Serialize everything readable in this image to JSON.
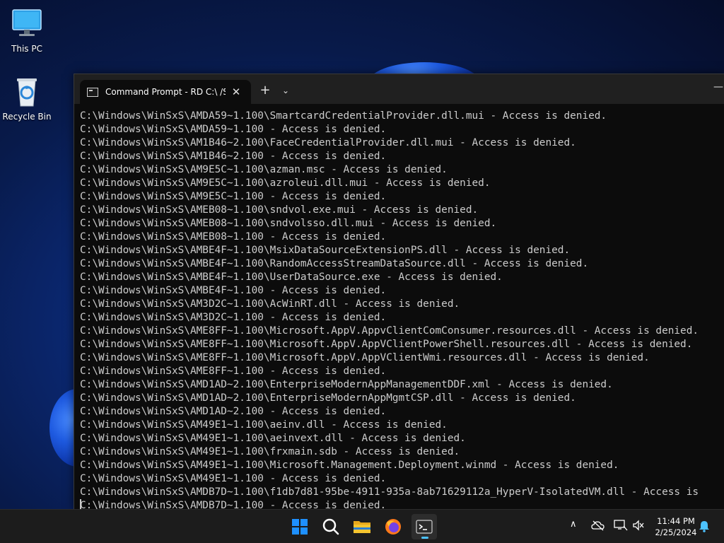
{
  "desktop": {
    "icons": [
      {
        "label": "This PC",
        "icon": "monitor-icon"
      },
      {
        "label": "Recycle Bin",
        "icon": "recycle-bin-icon"
      }
    ]
  },
  "terminal": {
    "tab_title": "Command Prompt - RD  C:\\ /S",
    "close_symbol": "✕",
    "new_tab_symbol": "+",
    "dropdown_symbol": "⌄",
    "minimize_symbol": "—",
    "lines": [
      "C:\\Windows\\WinSxS\\AMDA59~1.100\\SmartcardCredentialProvider.dll.mui - Access is denied.",
      "C:\\Windows\\WinSxS\\AMDA59~1.100 - Access is denied.",
      "C:\\Windows\\WinSxS\\AM1B46~2.100\\FaceCredentialProvider.dll.mui - Access is denied.",
      "C:\\Windows\\WinSxS\\AM1B46~2.100 - Access is denied.",
      "C:\\Windows\\WinSxS\\AM9E5C~1.100\\azman.msc - Access is denied.",
      "C:\\Windows\\WinSxS\\AM9E5C~1.100\\azroleui.dll.mui - Access is denied.",
      "C:\\Windows\\WinSxS\\AM9E5C~1.100 - Access is denied.",
      "C:\\Windows\\WinSxS\\AMEB08~1.100\\sndvol.exe.mui - Access is denied.",
      "C:\\Windows\\WinSxS\\AMEB08~1.100\\sndvolsso.dll.mui - Access is denied.",
      "C:\\Windows\\WinSxS\\AMEB08~1.100 - Access is denied.",
      "C:\\Windows\\WinSxS\\AMBE4F~1.100\\MsixDataSourceExtensionPS.dll - Access is denied.",
      "C:\\Windows\\WinSxS\\AMBE4F~1.100\\RandomAccessStreamDataSource.dll - Access is denied.",
      "C:\\Windows\\WinSxS\\AMBE4F~1.100\\UserDataSource.exe - Access is denied.",
      "C:\\Windows\\WinSxS\\AMBE4F~1.100 - Access is denied.",
      "C:\\Windows\\WinSxS\\AM3D2C~1.100\\AcWinRT.dll - Access is denied.",
      "C:\\Windows\\WinSxS\\AM3D2C~1.100 - Access is denied.",
      "C:\\Windows\\WinSxS\\AME8FF~1.100\\Microsoft.AppV.AppvClientComConsumer.resources.dll - Access is denied.",
      "C:\\Windows\\WinSxS\\AME8FF~1.100\\Microsoft.AppV.AppVClientPowerShell.resources.dll - Access is denied.",
      "C:\\Windows\\WinSxS\\AME8FF~1.100\\Microsoft.AppV.AppVClientWmi.resources.dll - Access is denied.",
      "C:\\Windows\\WinSxS\\AME8FF~1.100 - Access is denied.",
      "C:\\Windows\\WinSxS\\AMD1AD~2.100\\EnterpriseModernAppManagementDDF.xml - Access is denied.",
      "C:\\Windows\\WinSxS\\AMD1AD~2.100\\EnterpriseModernAppMgmtCSP.dll - Access is denied.",
      "C:\\Windows\\WinSxS\\AMD1AD~2.100 - Access is denied.",
      "C:\\Windows\\WinSxS\\AM49E1~1.100\\aeinv.dll - Access is denied.",
      "C:\\Windows\\WinSxS\\AM49E1~1.100\\aeinvext.dll - Access is denied.",
      "C:\\Windows\\WinSxS\\AM49E1~1.100\\frxmain.sdb - Access is denied.",
      "C:\\Windows\\WinSxS\\AM49E1~1.100\\Microsoft.Management.Deployment.winmd - Access is denied.",
      "C:\\Windows\\WinSxS\\AM49E1~1.100 - Access is denied.",
      "C:\\Windows\\WinSxS\\AMDB7D~1.100\\f1db7d81-95be-4911-935a-8ab71629112a_HyperV-IsolatedVM.dll - Access is",
      "C:\\Windows\\WinSxS\\AMDB7D~1.100 - Access is denied."
    ]
  },
  "taskbar": {
    "apps": [
      {
        "name": "start-button",
        "icon": "windows-logo-icon"
      },
      {
        "name": "search-button",
        "icon": "search-icon"
      },
      {
        "name": "file-explorer-button",
        "icon": "folder-icon"
      },
      {
        "name": "firefox-button",
        "icon": "firefox-icon"
      },
      {
        "name": "terminal-button",
        "icon": "terminal-icon",
        "active": true
      }
    ],
    "tray": {
      "chevron_symbol": "∧",
      "time": "11:44 PM",
      "date": "2/25/2024"
    }
  },
  "colors": {
    "terminal_bg": "#0c0c0c",
    "terminal_text": "#cccccc",
    "titlebar_bg": "#202020",
    "taskbar_bg": "#1c1c1c",
    "accent": "#4cc2ff",
    "windows_blue": "#1e90ff",
    "folder_yellow": "#f4c430"
  }
}
